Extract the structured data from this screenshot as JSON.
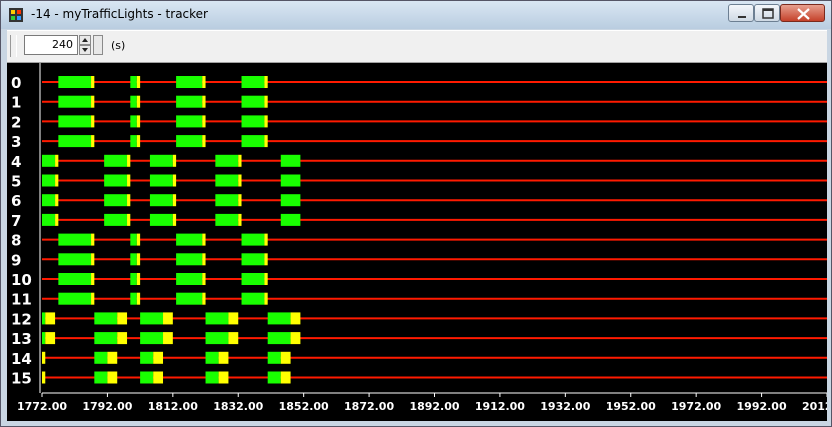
{
  "window": {
    "title": "-14 - myTrafficLights - tracker"
  },
  "toolbar": {
    "time_window": "240",
    "unit_label": "(s)"
  },
  "colors": {
    "green": "#19ff00",
    "yellow": "#ffff00",
    "red": "#ff1a00",
    "orange": "#e8a040",
    "background": "#000000",
    "text": "#ffffff"
  },
  "tracker": {
    "x_ticks": [
      "1772.00",
      "1792.00",
      "1812.00",
      "1832.00",
      "1852.00",
      "1872.00",
      "1892.00",
      "1912.00",
      "1932.00",
      "1952.00",
      "1972.00",
      "1992.00",
      "2012.00"
    ],
    "x_range": [
      1772,
      2012
    ],
    "tracks": [
      {
        "label": "0",
        "red": "#ff1a00",
        "segments": [
          {
            "c": "green",
            "s": 1777,
            "e": 1787
          },
          {
            "c": "yellow",
            "s": 1787,
            "e": 1788
          },
          {
            "c": "green",
            "s": 1799,
            "e": 1801
          },
          {
            "c": "yellow",
            "s": 1801,
            "e": 1802
          },
          {
            "c": "green",
            "s": 1813,
            "e": 1821
          },
          {
            "c": "yellow",
            "s": 1821,
            "e": 1822
          },
          {
            "c": "green",
            "s": 1833,
            "e": 1840
          },
          {
            "c": "yellow",
            "s": 1840,
            "e": 1841
          }
        ]
      },
      {
        "label": "1",
        "red": "#ff1a00",
        "segments": [
          {
            "c": "green",
            "s": 1777,
            "e": 1787
          },
          {
            "c": "yellow",
            "s": 1787,
            "e": 1788
          },
          {
            "c": "green",
            "s": 1799,
            "e": 1801
          },
          {
            "c": "yellow",
            "s": 1801,
            "e": 1802
          },
          {
            "c": "green",
            "s": 1813,
            "e": 1821
          },
          {
            "c": "yellow",
            "s": 1821,
            "e": 1822
          },
          {
            "c": "green",
            "s": 1833,
            "e": 1840
          },
          {
            "c": "yellow",
            "s": 1840,
            "e": 1841
          }
        ]
      },
      {
        "label": "2",
        "red": "#ff1a00",
        "segments": [
          {
            "c": "green",
            "s": 1777,
            "e": 1787
          },
          {
            "c": "yellow",
            "s": 1787,
            "e": 1788
          },
          {
            "c": "green",
            "s": 1799,
            "e": 1801
          },
          {
            "c": "yellow",
            "s": 1801,
            "e": 1802
          },
          {
            "c": "green",
            "s": 1813,
            "e": 1821
          },
          {
            "c": "yellow",
            "s": 1821,
            "e": 1822
          },
          {
            "c": "green",
            "s": 1833,
            "e": 1840
          },
          {
            "c": "yellow",
            "s": 1840,
            "e": 1841
          }
        ]
      },
      {
        "label": "3",
        "red": "#ff1a00",
        "segments": [
          {
            "c": "green",
            "s": 1777,
            "e": 1787
          },
          {
            "c": "yellow",
            "s": 1787,
            "e": 1788
          },
          {
            "c": "green",
            "s": 1799,
            "e": 1801
          },
          {
            "c": "yellow",
            "s": 1801,
            "e": 1802
          },
          {
            "c": "green",
            "s": 1813,
            "e": 1821
          },
          {
            "c": "yellow",
            "s": 1821,
            "e": 1822
          },
          {
            "c": "green",
            "s": 1833,
            "e": 1840
          },
          {
            "c": "yellow",
            "s": 1840,
            "e": 1841
          }
        ]
      },
      {
        "label": "4",
        "red": "#ff1a00",
        "segments": [
          {
            "c": "green",
            "s": 1772,
            "e": 1776
          },
          {
            "c": "yellow",
            "s": 1776,
            "e": 1777
          },
          {
            "c": "green",
            "s": 1791,
            "e": 1798
          },
          {
            "c": "yellow",
            "s": 1798,
            "e": 1799
          },
          {
            "c": "green",
            "s": 1805,
            "e": 1812
          },
          {
            "c": "yellow",
            "s": 1812,
            "e": 1813
          },
          {
            "c": "green",
            "s": 1825,
            "e": 1832
          },
          {
            "c": "yellow",
            "s": 1832,
            "e": 1833
          },
          {
            "c": "green",
            "s": 1845,
            "e": 1851
          }
        ]
      },
      {
        "label": "5",
        "red": "#ff1a00",
        "segments": [
          {
            "c": "green",
            "s": 1772,
            "e": 1776
          },
          {
            "c": "yellow",
            "s": 1776,
            "e": 1777
          },
          {
            "c": "green",
            "s": 1791,
            "e": 1798
          },
          {
            "c": "yellow",
            "s": 1798,
            "e": 1799
          },
          {
            "c": "green",
            "s": 1805,
            "e": 1812
          },
          {
            "c": "yellow",
            "s": 1812,
            "e": 1813
          },
          {
            "c": "green",
            "s": 1825,
            "e": 1832
          },
          {
            "c": "yellow",
            "s": 1832,
            "e": 1833
          },
          {
            "c": "green",
            "s": 1845,
            "e": 1851
          }
        ]
      },
      {
        "label": "6",
        "red": "#ff1a00",
        "segments": [
          {
            "c": "green",
            "s": 1772,
            "e": 1776
          },
          {
            "c": "yellow",
            "s": 1776,
            "e": 1777
          },
          {
            "c": "green",
            "s": 1791,
            "e": 1798
          },
          {
            "c": "yellow",
            "s": 1798,
            "e": 1799
          },
          {
            "c": "green",
            "s": 1805,
            "e": 1812
          },
          {
            "c": "yellow",
            "s": 1812,
            "e": 1813
          },
          {
            "c": "green",
            "s": 1825,
            "e": 1832
          },
          {
            "c": "yellow",
            "s": 1832,
            "e": 1833
          },
          {
            "c": "green",
            "s": 1845,
            "e": 1851
          }
        ]
      },
      {
        "label": "7",
        "red": "#ff1a00",
        "segments": [
          {
            "c": "green",
            "s": 1772,
            "e": 1776
          },
          {
            "c": "yellow",
            "s": 1776,
            "e": 1777
          },
          {
            "c": "green",
            "s": 1791,
            "e": 1798
          },
          {
            "c": "yellow",
            "s": 1798,
            "e": 1799
          },
          {
            "c": "green",
            "s": 1805,
            "e": 1812
          },
          {
            "c": "yellow",
            "s": 1812,
            "e": 1813
          },
          {
            "c": "green",
            "s": 1825,
            "e": 1832
          },
          {
            "c": "yellow",
            "s": 1832,
            "e": 1833
          },
          {
            "c": "green",
            "s": 1845,
            "e": 1851
          }
        ]
      },
      {
        "label": "8",
        "red": "#ff1a00",
        "segments": [
          {
            "c": "green",
            "s": 1777,
            "e": 1787
          },
          {
            "c": "yellow",
            "s": 1787,
            "e": 1788
          },
          {
            "c": "green",
            "s": 1799,
            "e": 1801
          },
          {
            "c": "yellow",
            "s": 1801,
            "e": 1802
          },
          {
            "c": "green",
            "s": 1813,
            "e": 1821
          },
          {
            "c": "yellow",
            "s": 1821,
            "e": 1822
          },
          {
            "c": "green",
            "s": 1833,
            "e": 1840
          },
          {
            "c": "yellow",
            "s": 1840,
            "e": 1841
          }
        ]
      },
      {
        "label": "9",
        "red": "#ff1a00",
        "segments": [
          {
            "c": "green",
            "s": 1777,
            "e": 1787
          },
          {
            "c": "yellow",
            "s": 1787,
            "e": 1788
          },
          {
            "c": "green",
            "s": 1799,
            "e": 1801
          },
          {
            "c": "yellow",
            "s": 1801,
            "e": 1802
          },
          {
            "c": "green",
            "s": 1813,
            "e": 1821
          },
          {
            "c": "yellow",
            "s": 1821,
            "e": 1822
          },
          {
            "c": "green",
            "s": 1833,
            "e": 1840
          },
          {
            "c": "yellow",
            "s": 1840,
            "e": 1841
          }
        ]
      },
      {
        "label": "10",
        "red": "#ff1a00",
        "segments": [
          {
            "c": "green",
            "s": 1777,
            "e": 1787
          },
          {
            "c": "yellow",
            "s": 1787,
            "e": 1788
          },
          {
            "c": "green",
            "s": 1799,
            "e": 1801
          },
          {
            "c": "yellow",
            "s": 1801,
            "e": 1802
          },
          {
            "c": "green",
            "s": 1813,
            "e": 1821
          },
          {
            "c": "yellow",
            "s": 1821,
            "e": 1822
          },
          {
            "c": "green",
            "s": 1833,
            "e": 1840
          },
          {
            "c": "yellow",
            "s": 1840,
            "e": 1841
          }
        ]
      },
      {
        "label": "11",
        "red": "#ff1a00",
        "segments": [
          {
            "c": "green",
            "s": 1777,
            "e": 1787
          },
          {
            "c": "yellow",
            "s": 1787,
            "e": 1788
          },
          {
            "c": "green",
            "s": 1799,
            "e": 1801
          },
          {
            "c": "yellow",
            "s": 1801,
            "e": 1802
          },
          {
            "c": "green",
            "s": 1813,
            "e": 1821
          },
          {
            "c": "yellow",
            "s": 1821,
            "e": 1822
          },
          {
            "c": "green",
            "s": 1833,
            "e": 1840
          },
          {
            "c": "yellow",
            "s": 1840,
            "e": 1841
          }
        ]
      },
      {
        "label": "12",
        "red": "#ff1a00",
        "segments": [
          {
            "c": "green",
            "s": 1772,
            "e": 1773
          },
          {
            "c": "yellow",
            "s": 1773,
            "e": 1776
          },
          {
            "c": "green",
            "s": 1788,
            "e": 1795
          },
          {
            "c": "yellow",
            "s": 1795,
            "e": 1798
          },
          {
            "c": "green",
            "s": 1802,
            "e": 1809
          },
          {
            "c": "yellow",
            "s": 1809,
            "e": 1812
          },
          {
            "c": "green",
            "s": 1822,
            "e": 1829
          },
          {
            "c": "yellow",
            "s": 1829,
            "e": 1832
          },
          {
            "c": "green",
            "s": 1841,
            "e": 1848
          },
          {
            "c": "yellow",
            "s": 1848,
            "e": 1851
          }
        ]
      },
      {
        "label": "13",
        "red": "#ff1a00",
        "segments": [
          {
            "c": "green",
            "s": 1772,
            "e": 1773
          },
          {
            "c": "yellow",
            "s": 1773,
            "e": 1776
          },
          {
            "c": "green",
            "s": 1788,
            "e": 1795
          },
          {
            "c": "yellow",
            "s": 1795,
            "e": 1798
          },
          {
            "c": "green",
            "s": 1802,
            "e": 1809
          },
          {
            "c": "yellow",
            "s": 1809,
            "e": 1812
          },
          {
            "c": "green",
            "s": 1822,
            "e": 1829
          },
          {
            "c": "yellow",
            "s": 1829,
            "e": 1832
          },
          {
            "c": "green",
            "s": 1841,
            "e": 1848
          },
          {
            "c": "yellow",
            "s": 1848,
            "e": 1851
          }
        ]
      },
      {
        "label": "14",
        "red": "#ff1a00",
        "segments": [
          {
            "c": "yellow",
            "s": 1772,
            "e": 1773
          },
          {
            "c": "green",
            "s": 1788,
            "e": 1792
          },
          {
            "c": "yellow",
            "s": 1792,
            "e": 1795
          },
          {
            "c": "green",
            "s": 1802,
            "e": 1806
          },
          {
            "c": "yellow",
            "s": 1806,
            "e": 1809
          },
          {
            "c": "green",
            "s": 1822,
            "e": 1826
          },
          {
            "c": "yellow",
            "s": 1826,
            "e": 1829
          },
          {
            "c": "green",
            "s": 1841,
            "e": 1845
          },
          {
            "c": "yellow",
            "s": 1845,
            "e": 1848
          }
        ]
      },
      {
        "label": "15",
        "red": "#ff1a00",
        "segments": [
          {
            "c": "yellow",
            "s": 1772,
            "e": 1773
          },
          {
            "c": "green",
            "s": 1788,
            "e": 1792
          },
          {
            "c": "yellow",
            "s": 1792,
            "e": 1795
          },
          {
            "c": "green",
            "s": 1802,
            "e": 1806
          },
          {
            "c": "yellow",
            "s": 1806,
            "e": 1809
          },
          {
            "c": "green",
            "s": 1822,
            "e": 1826
          },
          {
            "c": "yellow",
            "s": 1826,
            "e": 1829
          },
          {
            "c": "green",
            "s": 1841,
            "e": 1845
          },
          {
            "c": "yellow",
            "s": 1845,
            "e": 1848
          }
        ]
      }
    ]
  }
}
